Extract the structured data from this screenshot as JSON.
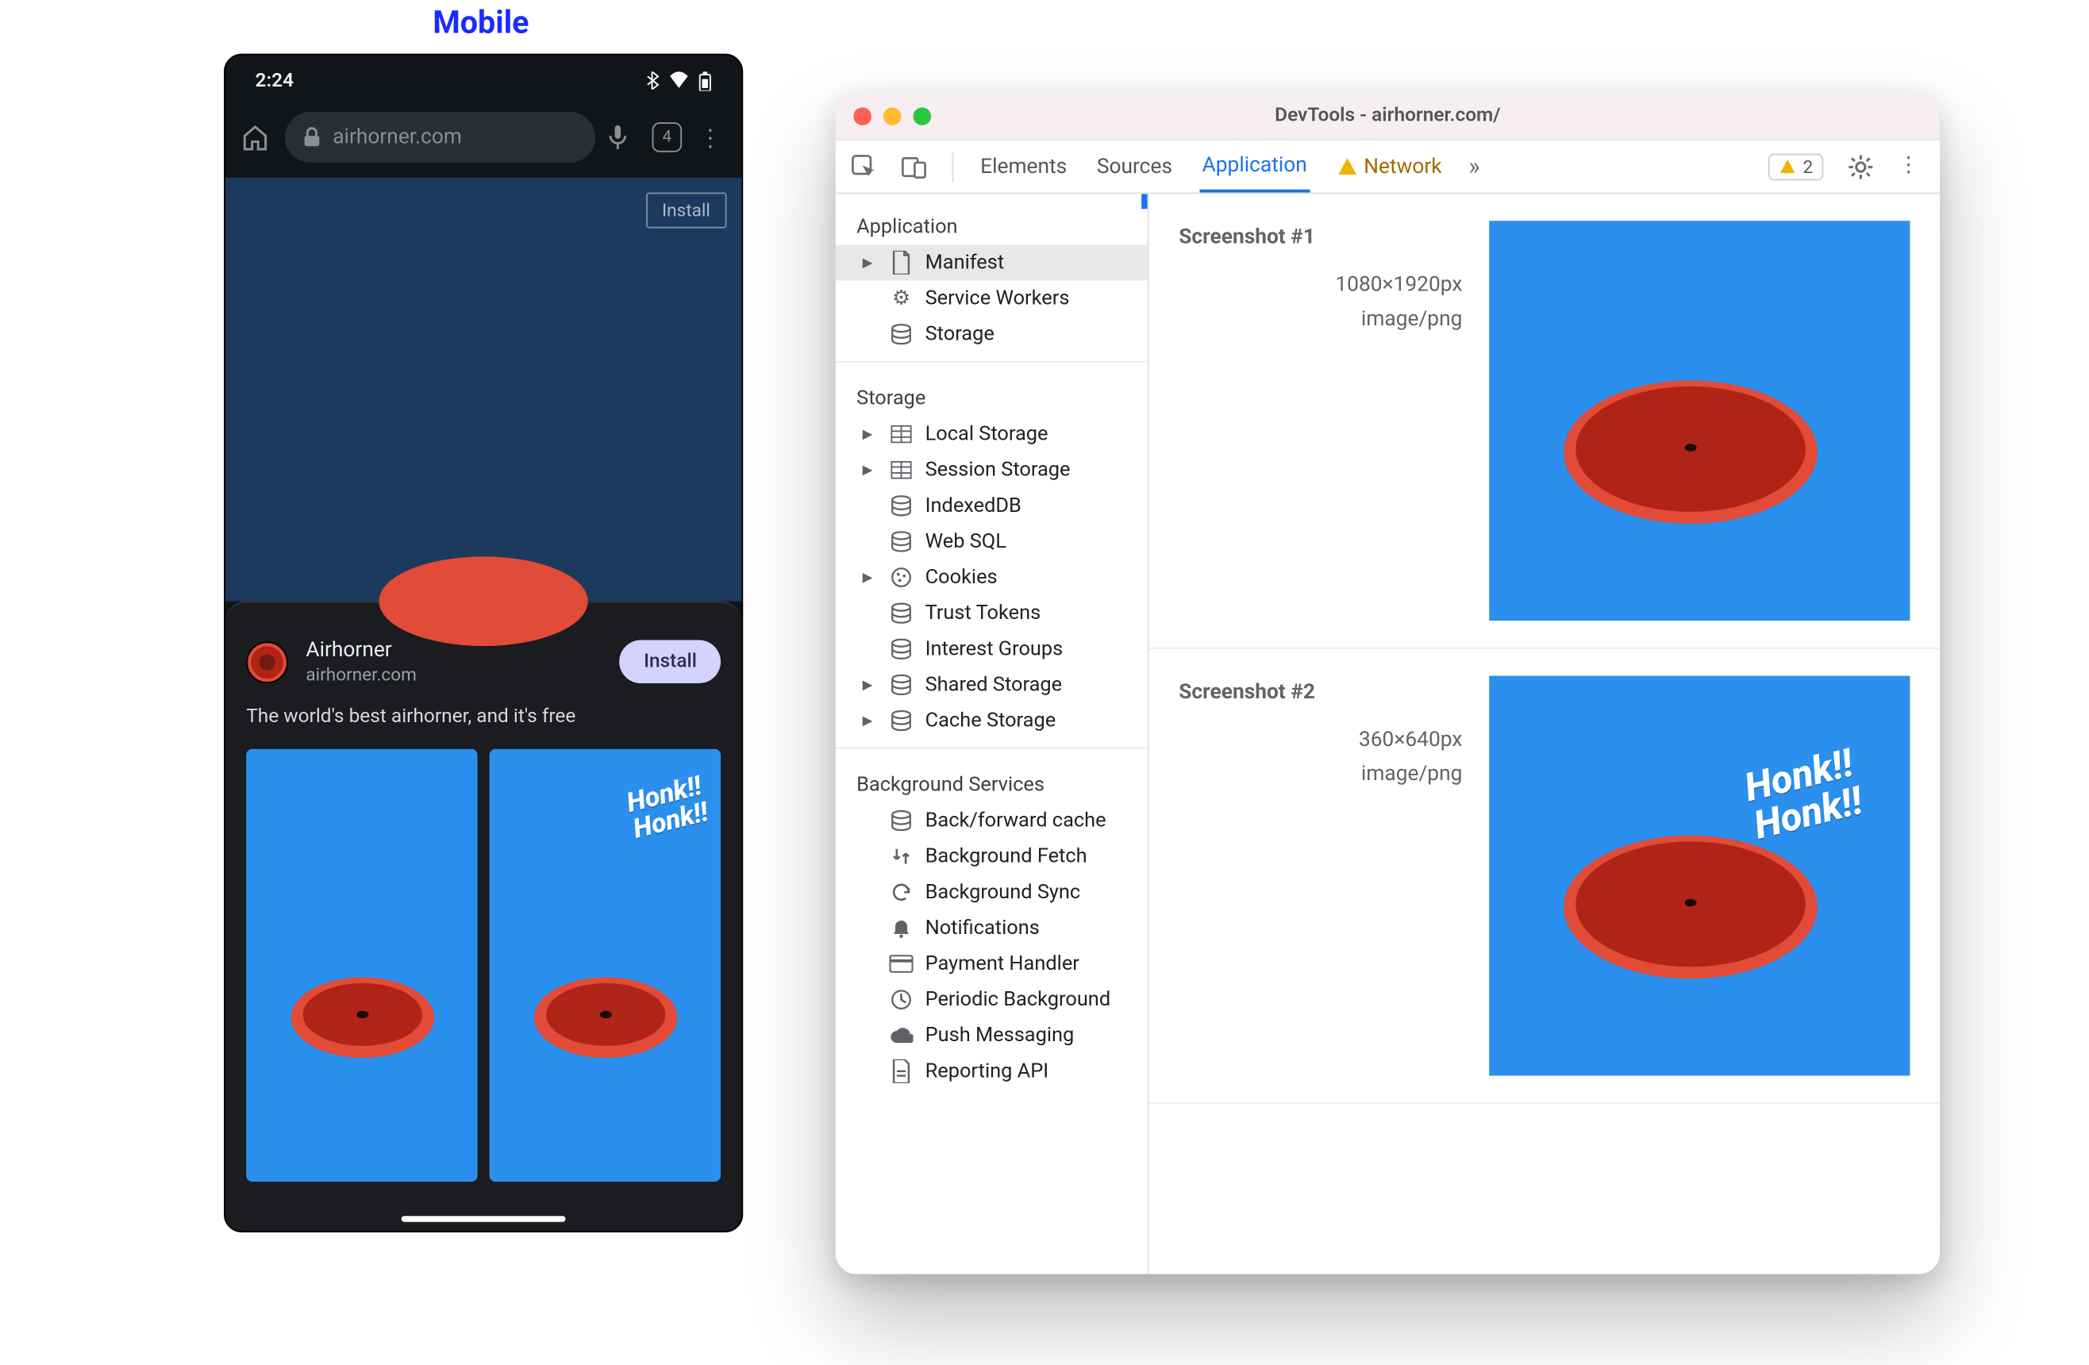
{
  "label_mobile": "Mobile",
  "phone": {
    "time": "2:24",
    "url": "airhorner.com",
    "tabs_count": "4",
    "install_btn_outline": "Install",
    "sheet": {
      "app_name": "Airhorner",
      "app_domain": "airhorner.com",
      "install_btn": "Install",
      "description": "The world's best airhorner, and it's free",
      "honk_line1": "Honk!!",
      "honk_line2": "Honk!!"
    }
  },
  "devtools": {
    "title": "DevTools - airhorner.com/",
    "tabs": {
      "elements": "Elements",
      "sources": "Sources",
      "application": "Application",
      "network": "Network"
    },
    "warn_count": "2",
    "sidebar": {
      "groups": {
        "application": "Application",
        "storage": "Storage",
        "background": "Background Services"
      },
      "items": {
        "manifest": "Manifest",
        "service_workers": "Service Workers",
        "storage_app": "Storage",
        "local_storage": "Local Storage",
        "session_storage": "Session Storage",
        "indexeddb": "IndexedDB",
        "websql": "Web SQL",
        "cookies": "Cookies",
        "trust_tokens": "Trust Tokens",
        "interest_groups": "Interest Groups",
        "shared_storage": "Shared Storage",
        "cache_storage": "Cache Storage",
        "bf_cache": "Back/forward cache",
        "bg_fetch": "Background Fetch",
        "bg_sync": "Background Sync",
        "notifications": "Notifications",
        "payment": "Payment Handler",
        "periodic": "Periodic Background",
        "push": "Push Messaging",
        "reporting": "Reporting API"
      }
    },
    "screenshots": [
      {
        "title": "Screenshot #1",
        "dims": "1080×1920px",
        "mime": "image/png",
        "honk": false
      },
      {
        "title": "Screenshot #2",
        "dims": "360×640px",
        "mime": "image/png",
        "honk": true
      }
    ],
    "honk_line1": "Honk!!",
    "honk_line2": "Honk!!"
  }
}
